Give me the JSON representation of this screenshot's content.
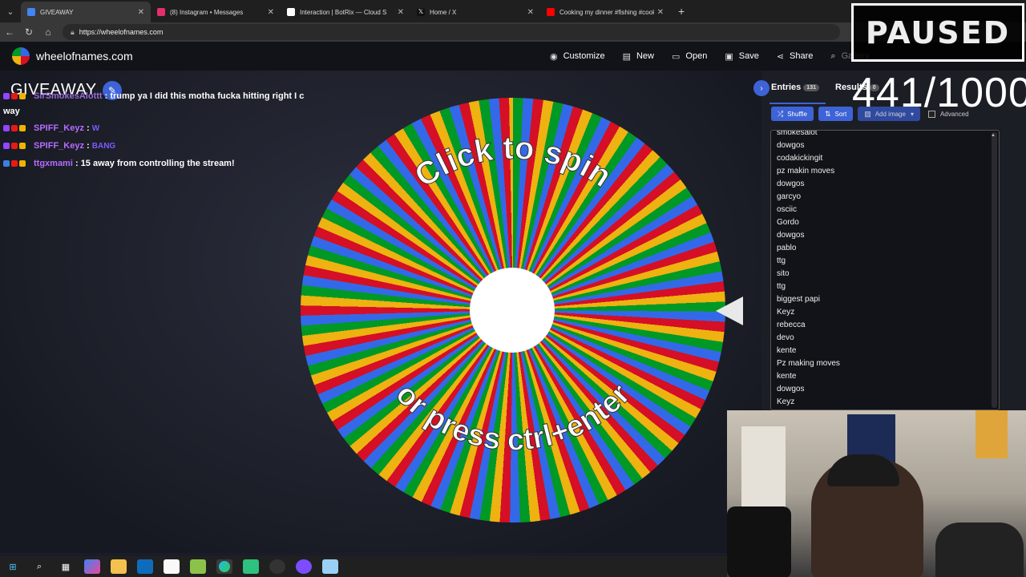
{
  "browser": {
    "tabs": [
      {
        "title": "GIVEAWAY",
        "color": "#4285f4",
        "active": true
      },
      {
        "title": "(8) Instagram • Messages",
        "color": "#e1306c",
        "active": false
      },
      {
        "title": "Interaction | BotRix — Cloud S",
        "color": "#ffffff",
        "active": false
      },
      {
        "title": "Home / X",
        "color": "#ffffff",
        "active": false
      },
      {
        "title": "Cooking my dinner #fishing #cook",
        "color": "#ff0000",
        "active": false
      }
    ],
    "url": "https://wheelofnames.com"
  },
  "app": {
    "brand": "wheelofnames.com",
    "menu": {
      "customize": "Customize",
      "new": "New",
      "open": "Open",
      "save": "Save",
      "share": "Share",
      "gallery": "Gallery"
    }
  },
  "main": {
    "title": "GIVEAWAY",
    "wheel_text_top": "Click to spin",
    "wheel_text_bottom": "or press ctrl+enter"
  },
  "chat": [
    {
      "user": "SirSmokesAlottt",
      "message": ": trump ya I did this motha fucka hitting right I c",
      "continuation": "way",
      "user_color": "#b66cff"
    },
    {
      "user": "SPIFF_Keyz",
      "message": ":",
      "emote": "W",
      "user_color": "#b66cff"
    },
    {
      "user": "SPIFF_Keyz",
      "message": ":",
      "emote": "BANG",
      "user_color": "#b66cff"
    },
    {
      "user": "ttgxmami",
      "message": ": 15 away from controlling the stream!",
      "user_color": "#b66cff"
    }
  ],
  "panel": {
    "tab_entries": "Entries",
    "entries_count": "131",
    "tab_results": "Results",
    "results_count": "0",
    "shuffle": "Shuffle",
    "sort": "Sort",
    "add_image": "Add image",
    "advanced": "Advanced",
    "entries": [
      "smokesalot",
      "dowgos",
      "codakickingit",
      "pz makin moves",
      "dowgos",
      "garcyo",
      "osciic",
      "Gordo",
      "dowgos",
      "pablo",
      "ttg",
      "sito",
      "ttg",
      "biggest papi",
      "Keyz",
      "rebecca",
      "devo",
      "kente",
      "Pz making moves",
      "kente",
      "dowgos",
      "Keyz"
    ]
  },
  "overlay": {
    "paused": "PAUSED",
    "counter": "441/1000"
  },
  "colors": {
    "wheel_green": "#009925",
    "wheel_blue": "#3369e8",
    "wheel_red": "#d50f25",
    "wheel_yellow": "#eeb211",
    "accent": "#3d63d6"
  }
}
